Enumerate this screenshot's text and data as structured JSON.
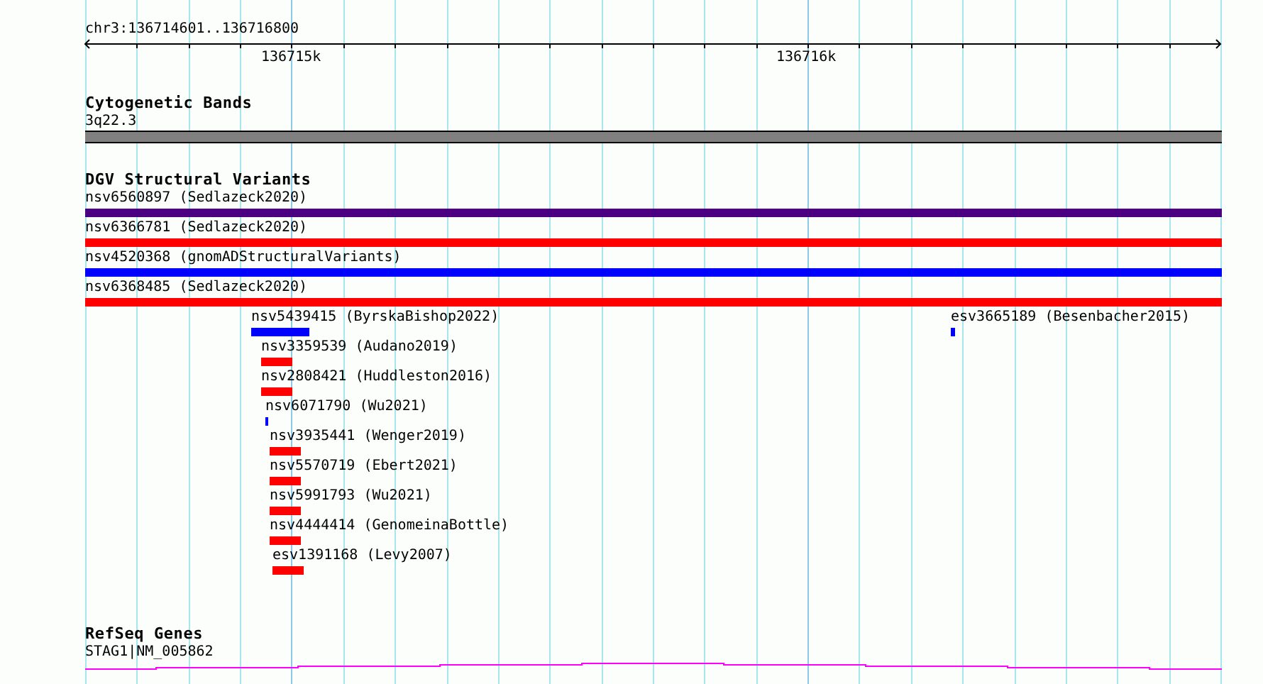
{
  "location": "chr3:136714601..136716800",
  "ruler": {
    "tick_labels": [
      "136715k",
      "136716k"
    ]
  },
  "tracks": [
    {
      "kind": "bands",
      "title": "Cytogenetic Bands",
      "features": [
        {
          "label": "3q22.3"
        }
      ]
    },
    {
      "kind": "variants",
      "title": "DGV Structural Variants",
      "features": [
        {
          "label": "nsv6560897 (Sedlazeck2020)",
          "color": "#4b0082"
        },
        {
          "label": "nsv6366781 (Sedlazeck2020)",
          "color": "#ff0000"
        },
        {
          "label": "nsv4520368 (gnomADStructuralVariants)",
          "color": "#0000ff"
        },
        {
          "label": "nsv6368485 (Sedlazeck2020)",
          "color": "#ff0000"
        },
        {
          "label": "nsv5439415 (ByrskaBishop2022)",
          "color": "#0000ff"
        },
        {
          "label": "esv3665189 (Besenbacher2015)",
          "color": "#0000ff"
        },
        {
          "label": "nsv3359539 (Audano2019)",
          "color": "#ff0000"
        },
        {
          "label": "nsv2808421 (Huddleston2016)",
          "color": "#ff0000"
        },
        {
          "label": "nsv6071790 (Wu2021)",
          "color": "#0000ff"
        },
        {
          "label": "nsv3935441 (Wenger2019)",
          "color": "#ff0000"
        },
        {
          "label": "nsv5570719 (Ebert2021)",
          "color": "#ff0000"
        },
        {
          "label": "nsv5991793 (Wu2021)",
          "color": "#ff0000"
        },
        {
          "label": "nsv4444414 (GenomeinaBottle)",
          "color": "#ff0000"
        },
        {
          "label": "esv1391168 (Levy2007)",
          "color": "#ff0000"
        }
      ]
    },
    {
      "kind": "genes",
      "title": "RefSeq Genes",
      "features": [
        {
          "label": "STAG1|NM_005862"
        }
      ]
    }
  ]
}
